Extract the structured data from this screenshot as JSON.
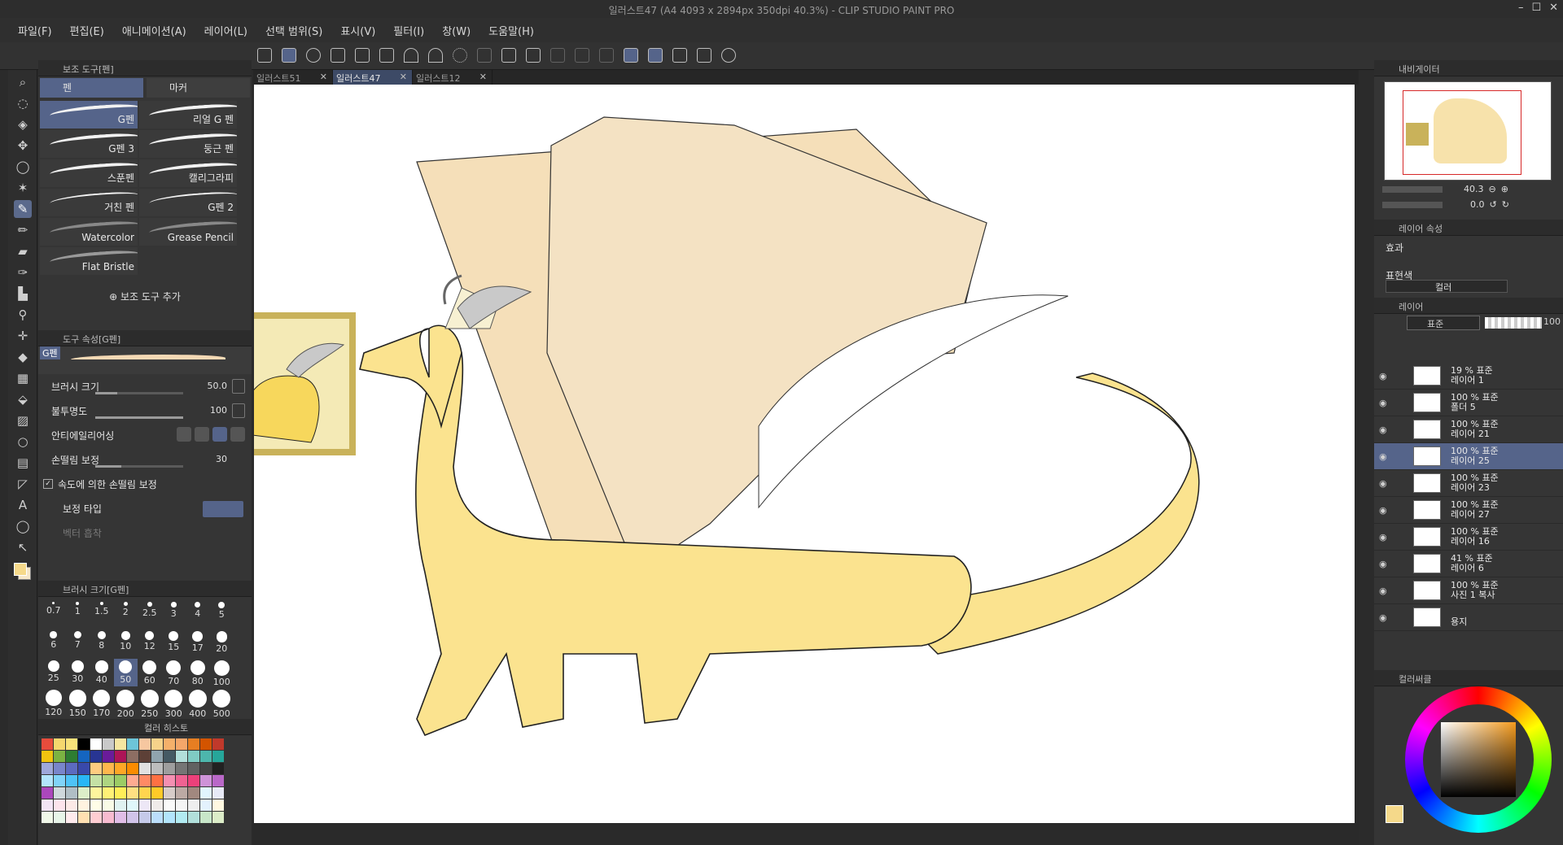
{
  "title": "일러스트47 (A4 4093 x 2894px 350dpi 40.3%)  - CLIP STUDIO PAINT PRO",
  "window_buttons": [
    "–",
    "☐",
    "✕"
  ],
  "menu": [
    "파일(F)",
    "편집(E)",
    "애니메이션(A)",
    "레이어(L)",
    "선택 범위(S)",
    "표시(V)",
    "필터(I)",
    "창(W)",
    "도움말(H)"
  ],
  "subtool_panel": {
    "title": "보조 도구[펜]",
    "tabs": [
      "펜",
      "마커"
    ],
    "brushes": [
      "G펜",
      "리얼 G 펜",
      "G펜 3",
      "둥근 펜",
      "스푼펜",
      "캘리그라피",
      "거친 펜",
      "G펜 2",
      "Watercolor",
      "Grease Pencil",
      "Flat Bristle"
    ],
    "add_label": "보조 도구 추가"
  },
  "tool_property": {
    "title": "도구 속성[G펜]",
    "preset": "G펜",
    "rows": [
      {
        "label": "브러시 크기",
        "value": "50.0",
        "fill": 0.25
      },
      {
        "label": "불투명도",
        "value": "100",
        "fill": 1.0
      },
      {
        "label": "안티에일리어싱",
        "value": ""
      },
      {
        "label": "손떨림 보정",
        "value": "30",
        "fill": 0.3
      },
      {
        "label": "속도에 의한 손떨림 보정",
        "value": ""
      },
      {
        "label": "보정 타입",
        "value": ""
      },
      {
        "label": "벡터 흡착",
        "value": ""
      }
    ]
  },
  "brush_size": {
    "title": "브러시 크기[G펜]",
    "sizes": [
      "0.7",
      "1",
      "1.5",
      "2",
      "2.5",
      "3",
      "4",
      "5",
      "6",
      "7",
      "8",
      "10",
      "12",
      "15",
      "17",
      "20",
      "25",
      "30",
      "40",
      "50",
      "60",
      "70",
      "80",
      "100",
      "120",
      "150",
      "170",
      "200",
      "250",
      "300",
      "400",
      "500"
    ],
    "selected": "50"
  },
  "color_history_title": "컬러 히스토",
  "palette": [
    "#e74c3c",
    "#f5d76e",
    "#f7e17a",
    "#000000",
    "#ffffff",
    "#c9c9c9",
    "#f5e6a1",
    "#6dc5d8",
    "#f6c7a0",
    "#f6d28a",
    "#f5b06a",
    "#f4a76a",
    "#e67e22",
    "#d35400",
    "#c0392b",
    "#f1c40f",
    "#7cb342",
    "#2e7d32",
    "#1565c0",
    "#283593",
    "#6a1b9a",
    "#ad1457",
    "#8d6e63",
    "#5d4037",
    "#90a4ae",
    "#455a64",
    "#b2dfdb",
    "#80cbc4",
    "#4db6ac",
    "#26a69a",
    "#9fa8da",
    "#7986cb",
    "#5c6bc0",
    "#3949ab",
    "#ffcc80",
    "#ffb74d",
    "#ffa726",
    "#fb8c00",
    "#e0e0e0",
    "#bdbdbd",
    "#9e9e9e",
    "#757575",
    "#616161",
    "#424242",
    "#212121",
    "#b3e5fc",
    "#81d4fa",
    "#4fc3f7",
    "#29b6f6",
    "#c5e1a5",
    "#aed581",
    "#9ccc65",
    "#ffab91",
    "#ff8a65",
    "#ff7043",
    "#f48fb1",
    "#f06292",
    "#ec407a",
    "#ce93d8",
    "#ba68c8",
    "#ab47bc",
    "#cfd8dc",
    "#b0bec5",
    "#dcedc8",
    "#fff59d",
    "#fff176",
    "#ffee58",
    "#ffe082",
    "#ffd54f",
    "#ffca28",
    "#d7ccc8",
    "#bcaaa4",
    "#a1887f",
    "#e1f5fe",
    "#e8eaf6",
    "#f3e5f5",
    "#fce4ec",
    "#fbe9e7",
    "#fff3e0",
    "#fffde7",
    "#f9fbe7",
    "#e0f2f1",
    "#e0f7fa",
    "#ede7f6",
    "#efebe9",
    "#fafafa",
    "#f5f5f5",
    "#eeeeee",
    "#e3f2fd",
    "#fff8e1",
    "#f1f8e9",
    "#e8f5e9",
    "#ffebee",
    "#ffe0b2",
    "#ffcdd2",
    "#f8bbd0",
    "#e1bee7",
    "#d1c4e9",
    "#c5cae9",
    "#bbdefb",
    "#b3e5fc",
    "#b2ebf2",
    "#b2dfdb",
    "#c8e6c9",
    "#dcedc8"
  ],
  "doc_tabs": [
    "일러스트51",
    "일러스트47",
    "일러스트12"
  ],
  "active_tab": 1,
  "navigator": {
    "title": "내비게이터",
    "zoom": "40.3",
    "rotate": "0.0"
  },
  "layer_property": {
    "title": "레이어 속성",
    "effect": "효과",
    "expression": "표현색",
    "expression_value": "컬러"
  },
  "layers_panel": {
    "title": "레이어",
    "blend": "표준",
    "opacity": "100"
  },
  "layers": [
    {
      "line1": "19 % 표준",
      "line2": "레이어 1",
      "selected": false
    },
    {
      "line1": "100 % 표준",
      "line2": "폴더 5",
      "selected": false
    },
    {
      "line1": "100 % 표준",
      "line2": "레이어 21",
      "selected": false
    },
    {
      "line1": "100 % 표준",
      "line2": "레이어 25",
      "selected": true
    },
    {
      "line1": "100 % 표준",
      "line2": "레이어 23",
      "selected": false
    },
    {
      "line1": "100 % 표준",
      "line2": "레이어 27",
      "selected": false
    },
    {
      "line1": "100 % 표준",
      "line2": "레이어 16",
      "selected": false
    },
    {
      "line1": "41 % 표준",
      "line2": "레이어 6",
      "selected": false
    },
    {
      "line1": "100 % 표준",
      "line2": "사진 1 복사",
      "selected": false
    },
    {
      "line1": "",
      "line2": "용지",
      "selected": false
    }
  ],
  "color_circle": {
    "title": "컬러써클",
    "main_color": "#f5d98a",
    "sub_color": "#f5e6c8"
  }
}
